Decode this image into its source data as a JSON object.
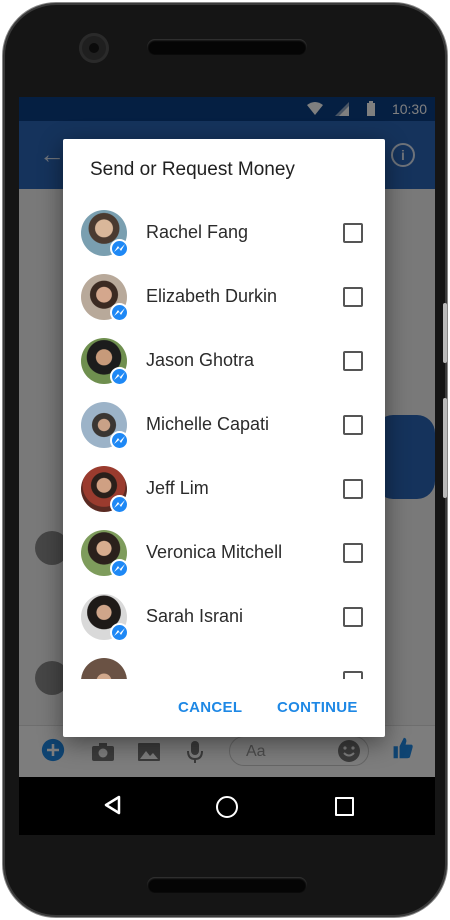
{
  "status_bar": {
    "time": "10:30"
  },
  "dialog": {
    "title": "Send or Request Money",
    "contacts": [
      {
        "name": "Rachel Fang"
      },
      {
        "name": "Elizabeth Durkin"
      },
      {
        "name": "Jason Ghotra"
      },
      {
        "name": "Michelle Capati"
      },
      {
        "name": "Jeff Lim"
      },
      {
        "name": "Veronica Mitchell"
      },
      {
        "name": "Sarah Israni"
      }
    ],
    "cancel_label": "CANCEL",
    "continue_label": "CONTINUE"
  },
  "composer": {
    "placeholder": "Aa"
  },
  "colors": {
    "status_bar": "#0b3e85",
    "app_bar": "#2a66b8",
    "accent": "#1e88e5",
    "messenger_badge": "#1e88f5"
  },
  "icons": {
    "status": [
      "wifi-icon",
      "signal-icon",
      "battery-icon"
    ],
    "app_bar": [
      "back-arrow-icon",
      "info-icon"
    ],
    "composer": [
      "add-icon",
      "camera-icon",
      "image-icon",
      "microphone-icon",
      "emoji-icon",
      "thumbs-up-icon"
    ],
    "nav": [
      "nav-back-icon",
      "nav-home-icon",
      "nav-recents-icon"
    ],
    "badge": "messenger-icon"
  }
}
